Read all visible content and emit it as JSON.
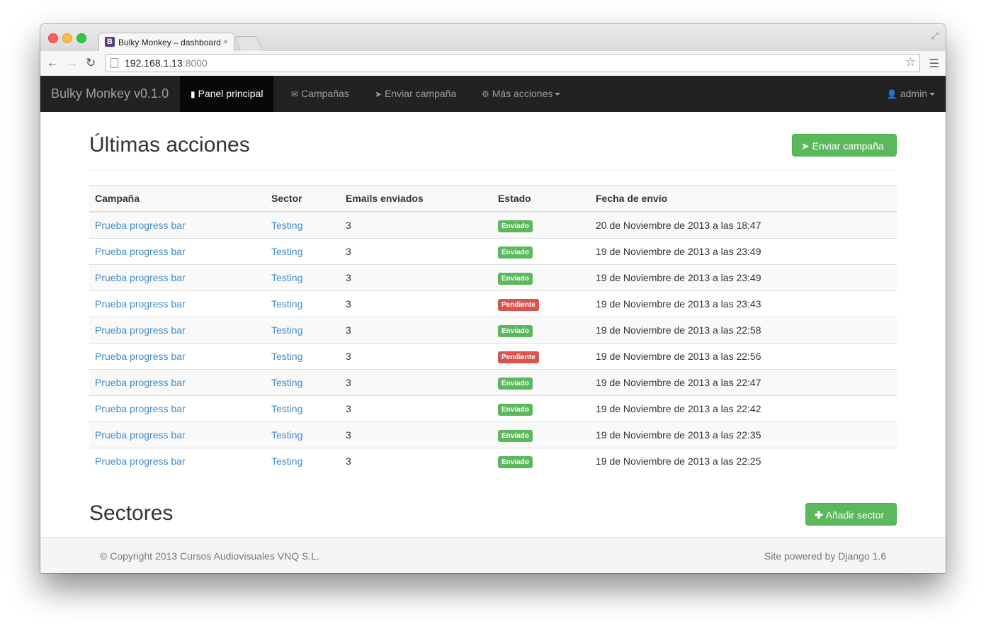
{
  "browser": {
    "tab_title": "Bulky Monkey – dashboard",
    "tab_close": "×",
    "favicon_letter": "B",
    "url_host": "192.168.1.13",
    "url_port": ":8000"
  },
  "navbar": {
    "brand": "Bulky Monkey v0.1.0",
    "items": [
      {
        "label": "Panel principal",
        "icon": "bar-chart-icon",
        "active": true
      },
      {
        "label": "Campañas",
        "icon": "envelope-icon",
        "active": false
      },
      {
        "label": "Enviar campaña",
        "icon": "send-icon",
        "active": false
      },
      {
        "label": "Más acciones",
        "icon": "gear-icon",
        "active": false
      }
    ],
    "user": "admin"
  },
  "main": {
    "title": "Últimas acciones",
    "send_button": "Enviar campaña",
    "table": {
      "headers": [
        "Campaña",
        "Sector",
        "Emails enviados",
        "Estado",
        "Fecha de envío"
      ],
      "rows": [
        {
          "campaign": "Prueba progress bar",
          "sector": "Testing",
          "emails": "3",
          "status": "Enviado",
          "status_type": "success",
          "date": "20 de Noviembre de 2013 a las 18:47"
        },
        {
          "campaign": "Prueba progress bar",
          "sector": "Testing",
          "emails": "3",
          "status": "Enviado",
          "status_type": "success",
          "date": "19 de Noviembre de 2013 a las 23:49"
        },
        {
          "campaign": "Prueba progress bar",
          "sector": "Testing",
          "emails": "3",
          "status": "Enviado",
          "status_type": "success",
          "date": "19 de Noviembre de 2013 a las 23:49"
        },
        {
          "campaign": "Prueba progress bar",
          "sector": "Testing",
          "emails": "3",
          "status": "Pendiente",
          "status_type": "danger",
          "date": "19 de Noviembre de 2013 a las 23:43"
        },
        {
          "campaign": "Prueba progress bar",
          "sector": "Testing",
          "emails": "3",
          "status": "Enviado",
          "status_type": "success",
          "date": "19 de Noviembre de 2013 a las 22:58"
        },
        {
          "campaign": "Prueba progress bar",
          "sector": "Testing",
          "emails": "3",
          "status": "Pendiente",
          "status_type": "danger",
          "date": "19 de Noviembre de 2013 a las 22:56"
        },
        {
          "campaign": "Prueba progress bar",
          "sector": "Testing",
          "emails": "3",
          "status": "Enviado",
          "status_type": "success",
          "date": "19 de Noviembre de 2013 a las 22:47"
        },
        {
          "campaign": "Prueba progress bar",
          "sector": "Testing",
          "emails": "3",
          "status": "Enviado",
          "status_type": "success",
          "date": "19 de Noviembre de 2013 a las 22:42"
        },
        {
          "campaign": "Prueba progress bar",
          "sector": "Testing",
          "emails": "3",
          "status": "Enviado",
          "status_type": "success",
          "date": "19 de Noviembre de 2013 a las 22:35"
        },
        {
          "campaign": "Prueba progress bar",
          "sector": "Testing",
          "emails": "3",
          "status": "Enviado",
          "status_type": "success",
          "date": "19 de Noviembre de 2013 a las 22:25"
        }
      ]
    },
    "sectors_title": "Sectores",
    "add_sector_button": "Añadir sector"
  },
  "footer": {
    "copyright": "© Copyright 2013 Cursos Audiovisuales VNQ S.L.",
    "powered": "Site powered by Django 1.6"
  },
  "colors": {
    "navbar_bg": "#222222",
    "success": "#5cb85c",
    "danger": "#d9534f",
    "link": "#428bca"
  }
}
